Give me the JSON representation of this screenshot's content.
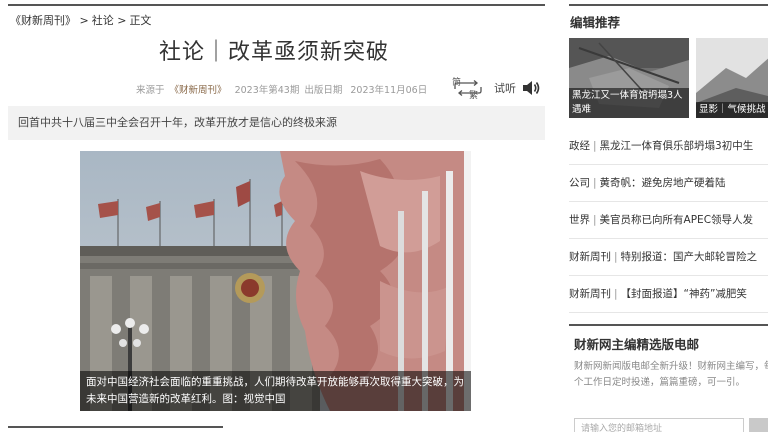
{
  "breadcrumb": {
    "magazine": "《财新周刊》",
    "level2": "社论",
    "level3": "正文",
    "sep": ">"
  },
  "article": {
    "title": "社论｜改革亟须新突破",
    "source_prefix": "来源于",
    "source": "《财新周刊》",
    "issue": "2023年第43期",
    "date_label": "出版日期",
    "date": "2023年11月06日",
    "jian": "简",
    "fan": "繁",
    "listen": "试听",
    "summary": "回首中共十八届三中全会召开十年，改革开放才是信心的终极来源",
    "caption": "面对中国经济社会面临的重重挑战，人们期待改革开放能够再次取得重大突破，为未来中国营造新的改革红利。图：视觉中国"
  },
  "sidebar": {
    "editor_title": "编辑推荐",
    "thumbs": [
      {
        "caption": "黑龙江又一体育馆坍塌3人遇难"
      },
      {
        "caption": "显影｜气候挑战"
      }
    ],
    "news": [
      {
        "cat": "政经",
        "text": "黑龙江一体育俱乐部坍塌3初中生"
      },
      {
        "cat": "公司",
        "text": "黄奇帆：避免房地产硬着陆"
      },
      {
        "cat": "世界",
        "text": "美官员称已向所有APEC领导人发"
      },
      {
        "cat": "财新周刊",
        "text": "特别报道：国产大邮轮冒险之"
      },
      {
        "cat": "财新周刊",
        "text": "【封面报道】“神药”减肥笑"
      }
    ],
    "paper_title": "财新网主编精选版电邮",
    "paper_desc": "财新网新闻版电邮全新升级！财新网主编写，每个工作日定时投递，篇篇重磅，可一引。",
    "email_placeholder": "请输入您的邮箱地址"
  },
  "icons": {
    "jianfan": "jianfan-switch-icon",
    "speaker": "speaker-icon"
  },
  "colors": {
    "rule": "#555555",
    "summary_bg": "#f2f2f2",
    "source": "#8a6a4a"
  }
}
